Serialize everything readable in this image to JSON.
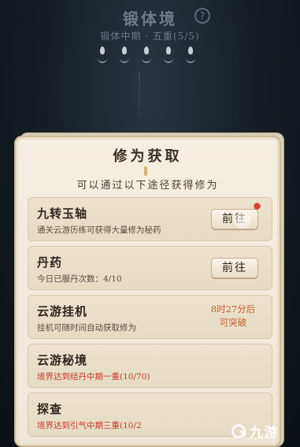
{
  "realm": {
    "title": "锻体境",
    "help_symbol": "?",
    "subtitle": "锻体中期 · 五重(5/5)",
    "stage_count": 5
  },
  "panel": {
    "title": "修为获取",
    "subtitle": "可以通过以下途径获得修为",
    "entries": [
      {
        "name": "九转玉轴",
        "desc": "通关云游历练可获得大量修为秘药",
        "action": "前往",
        "has_red_dot": true
      },
      {
        "name": "丹药",
        "desc": "今日已服丹次数：4/10",
        "action": "前往"
      },
      {
        "name": "云游挂机",
        "desc": "挂机可随时间自动获取修为",
        "timer_line1": "8时27分后",
        "timer_line2": "可突破"
      },
      {
        "name": "云游秘境",
        "desc": "境界达到结丹中期一重(10/70)"
      },
      {
        "name": "探查",
        "desc": "境界达到引气中期三重(10/2"
      }
    ]
  },
  "watermark": {
    "text": "九游"
  },
  "colors": {
    "red_text": "#c43a2c",
    "timer": "#c85a2a",
    "panel_bg": "#f5efe2"
  }
}
